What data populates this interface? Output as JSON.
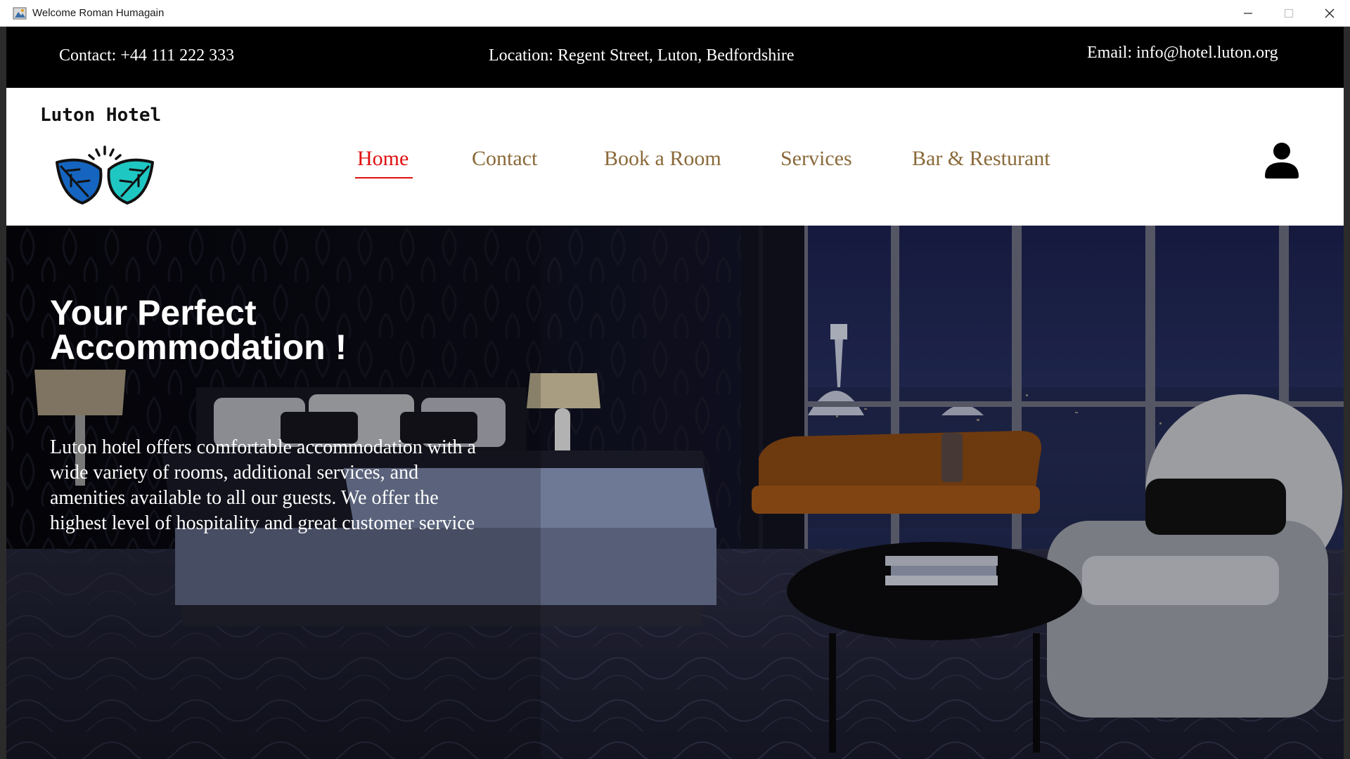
{
  "window": {
    "title": "Welcome Roman Humagain",
    "minimize_icon": "minimize-icon",
    "maximize_icon": "maximize-icon",
    "close_icon": "close-icon"
  },
  "infobar": {
    "contact": "Contact: +44 111 222 333",
    "location": "Location: Regent Street, Luton, Bedfordshire",
    "email": "Email: info@hotel.luton.org"
  },
  "brand": {
    "name": "Luton Hotel",
    "logo_icon": "leaf-logo-icon",
    "colors": {
      "dark_blue": "#1565c0",
      "teal": "#1fc7c2"
    }
  },
  "nav": {
    "items": [
      {
        "label": "Home",
        "active": true
      },
      {
        "label": "Contact",
        "active": false
      },
      {
        "label": "Book a Room",
        "active": false
      },
      {
        "label": "Services",
        "active": false
      },
      {
        "label": "Bar & Resturant",
        "active": false
      }
    ],
    "active_color": "#e01010",
    "item_color": "#8a6a3a",
    "user_icon": "user-icon"
  },
  "hero": {
    "title_line1": "Your Perfect",
    "title_line2": "Accommodation  !",
    "description": "Luton hotel offers comfortable accommodation with a wide variety of rooms, additional services, and amenities available to all our guests. We offer the highest level of hospitality and great customer service"
  }
}
